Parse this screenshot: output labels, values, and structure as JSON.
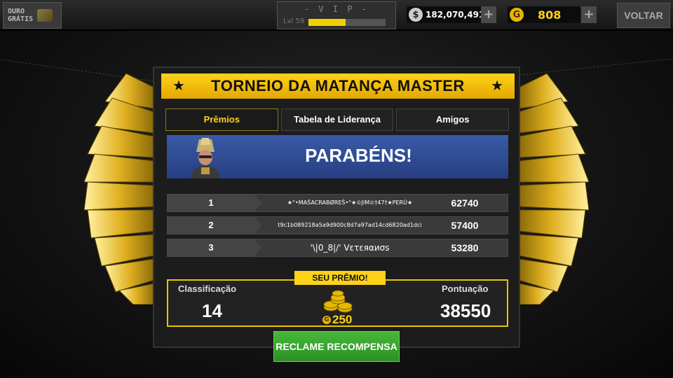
{
  "topbar": {
    "free_gold_label": "OURO\nGRÁTIS",
    "vip_title": "- V I P -",
    "level_label": "Lvl 59",
    "level_progress": 0.48,
    "money_symbol": "$",
    "money_value": "182,070,491",
    "gold_symbol": "G",
    "gold_value": "808",
    "plus_label": "+",
    "back_label": "VOLTAR"
  },
  "panel": {
    "title": "TORNEIO DA MATANÇA MASTER",
    "star": "★",
    "tabs": [
      {
        "label": "Prêmios",
        "active": true
      },
      {
        "label": "Tabela de Liderança",
        "active": false
      },
      {
        "label": "Amigos",
        "active": false
      }
    ],
    "congrats": "PARABÉNS!",
    "leaderboard": [
      {
        "rank": "1",
        "name": "★°•MAŠACRABØREŠ•°★♔JIM♔†47†★PERÚ★",
        "score": "62740"
      },
      {
        "rank": "2",
        "name": "t9c1b089218a5a9d900c8d7a97ad14cd6820ad1dci",
        "score": "57400"
      },
      {
        "rank": "3",
        "name": "'\\|0_8|/'   Vετεяαиσѕ",
        "score": "53280"
      }
    ],
    "result": {
      "rank_label": "Classificação",
      "rank_value": "14",
      "prize_tag": "SEU PRÊMIO!",
      "prize_value": "250",
      "prize_symbol": "G",
      "score_label": "Pontuação",
      "score_value": "38550"
    },
    "claim_label": "RECLAME RECOMPENSA"
  },
  "colors": {
    "gold": "#ffd21a",
    "blue_banner": "#2f4c94",
    "claim_green": "#3aa830"
  }
}
